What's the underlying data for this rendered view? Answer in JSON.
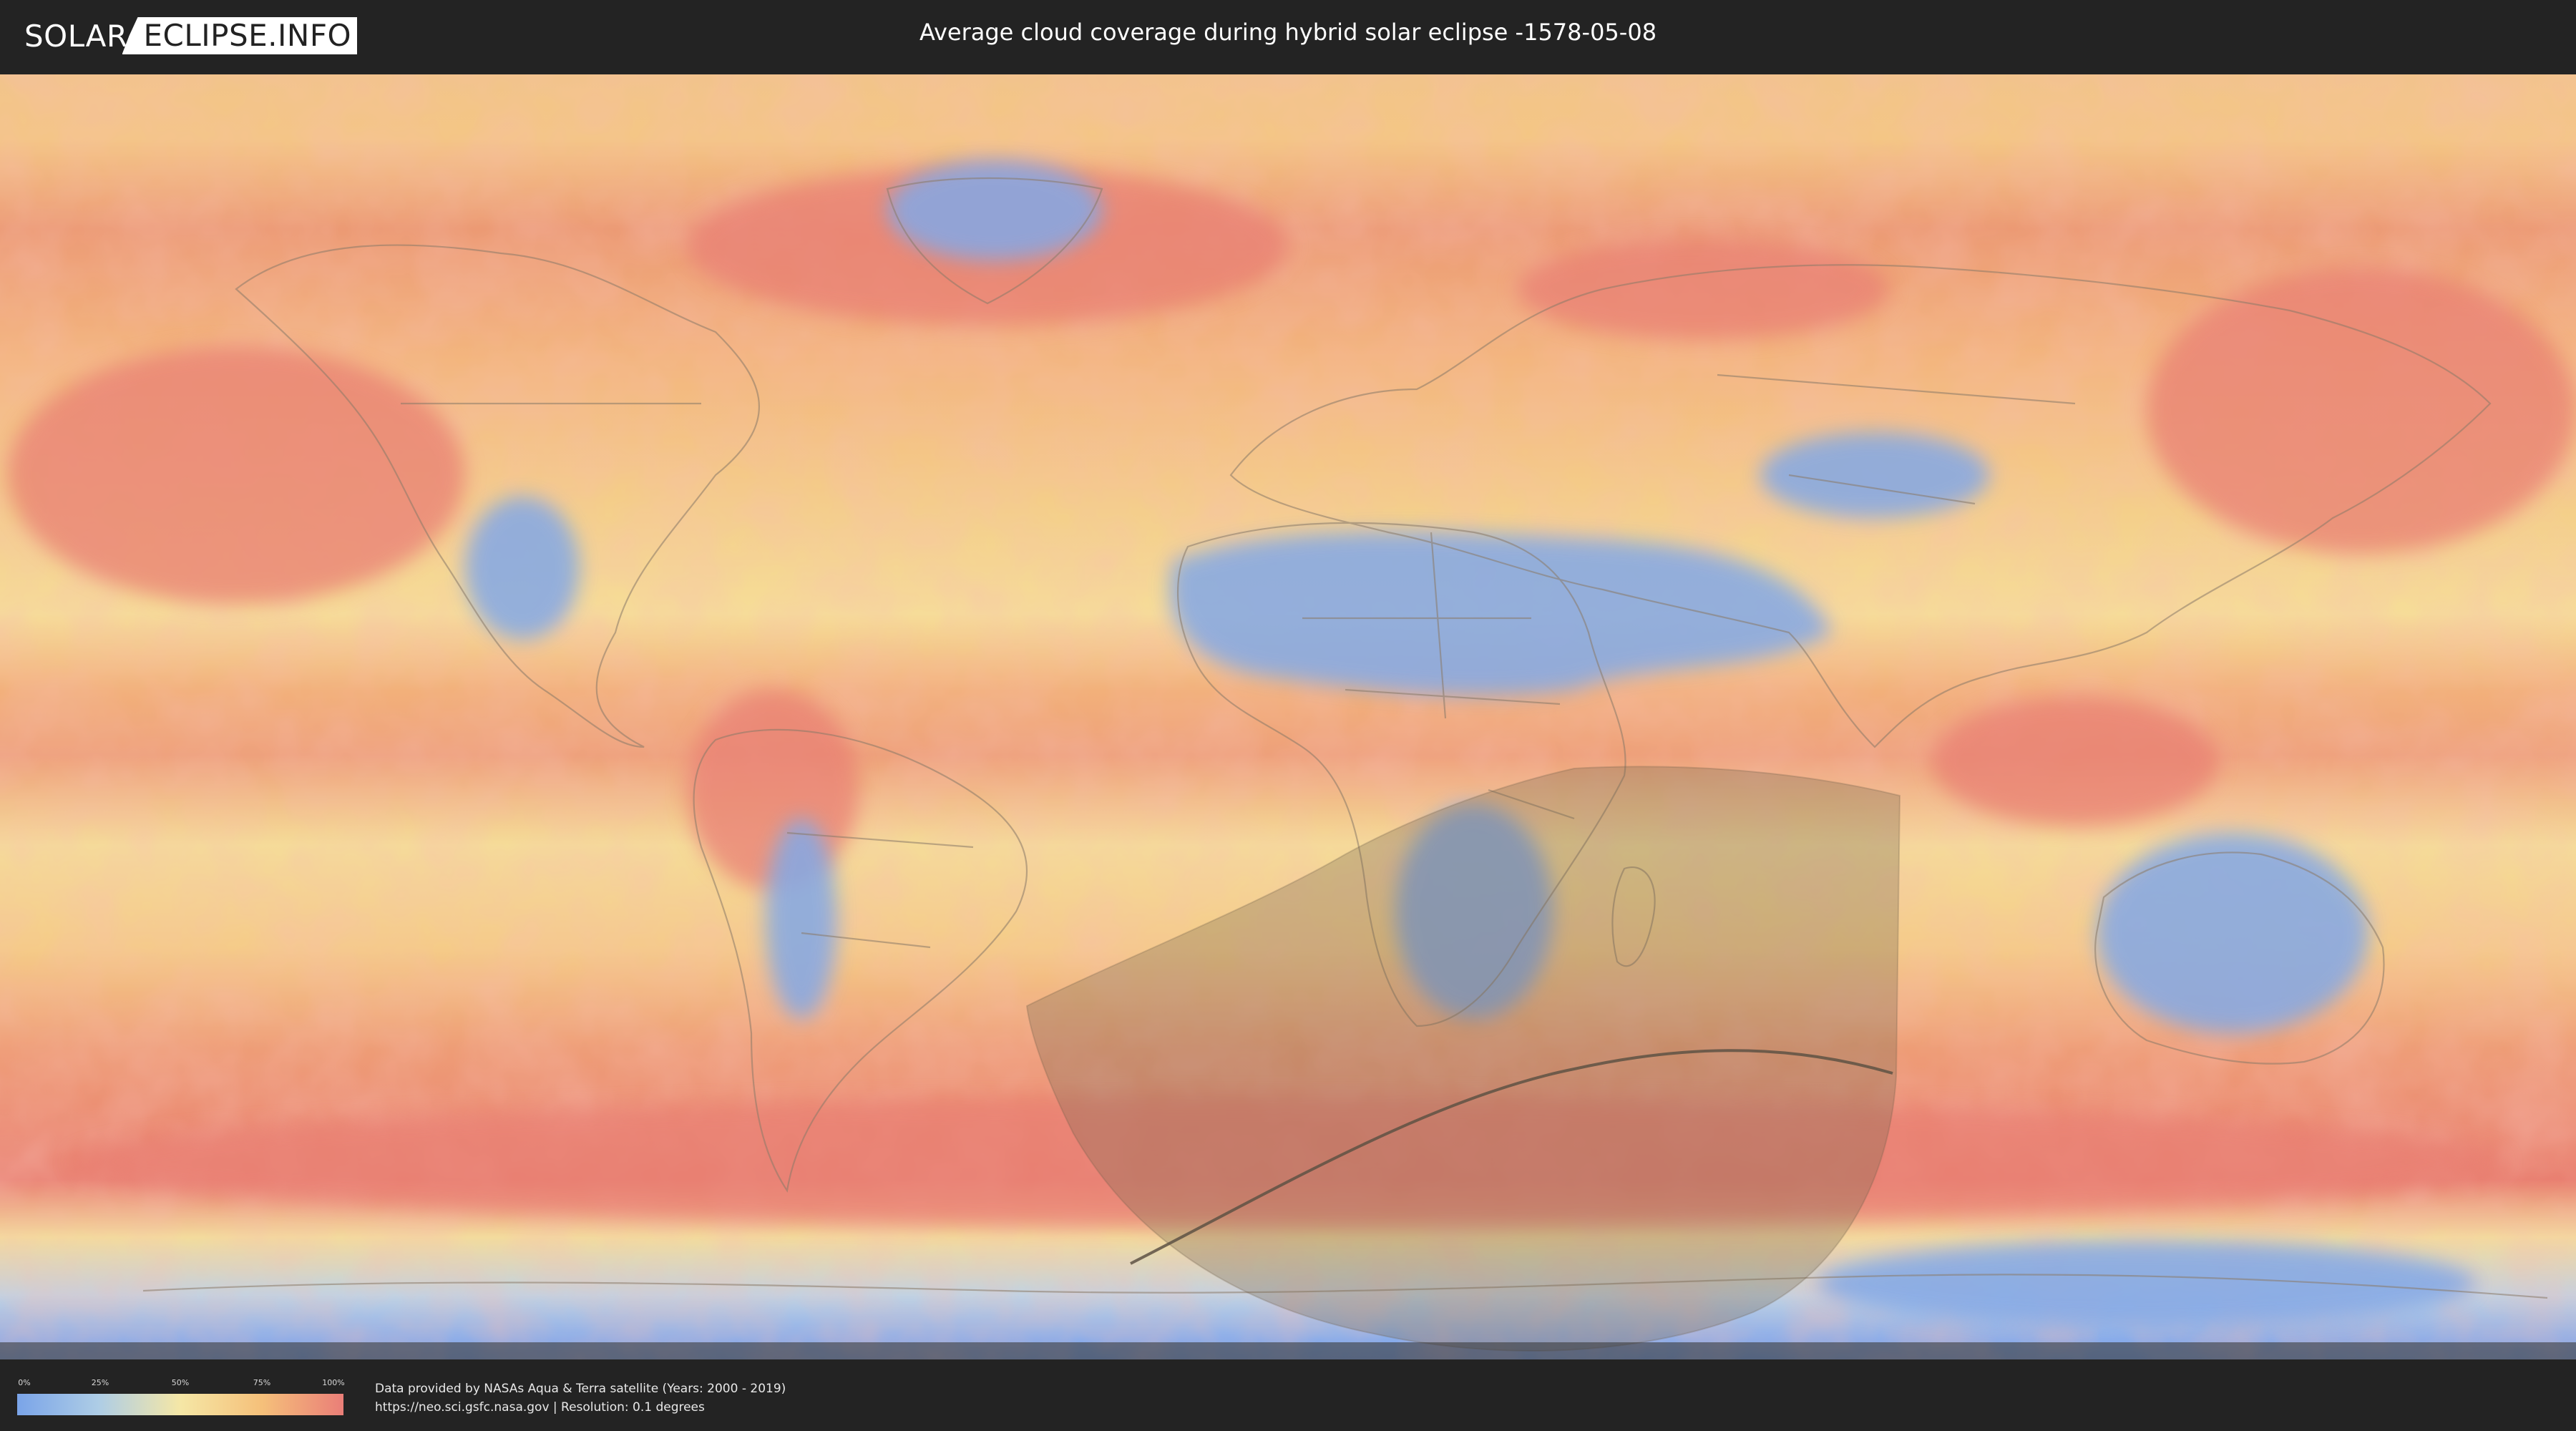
{
  "header": {
    "logo_left": "SOLAR",
    "logo_right": "ECLIPSE.INFO",
    "title": "Average cloud coverage during hybrid solar eclipse -1578-05-08"
  },
  "legend": {
    "ticks": [
      "0%",
      "25%",
      "50%",
      "75%",
      "100%"
    ],
    "colors": [
      "#7aa4e8",
      "#aecde6",
      "#f5e7a6",
      "#f5c07a",
      "#ea7e78"
    ]
  },
  "footer": {
    "credit_line_1": "Data provided by NASAs Aqua & Terra satellite (Years: 2000 - 2019)",
    "credit_line_2": "https://neo.sci.gsfc.nasa.gov | Resolution: 0.1 degrees"
  },
  "map": {
    "eclipse_type": "hybrid",
    "date": "-1578-05-08"
  }
}
